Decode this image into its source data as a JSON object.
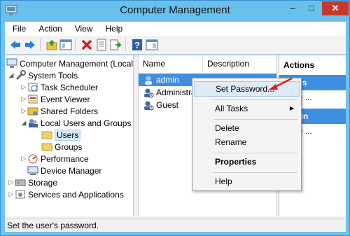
{
  "window": {
    "title": "Computer Management",
    "controls": {
      "minimize": "–",
      "maximize": "□",
      "close": "✕"
    }
  },
  "menubar": {
    "items": [
      "File",
      "Action",
      "View",
      "Help"
    ]
  },
  "toolbar": {
    "icons": [
      "back-icon",
      "forward-icon",
      "up-folder-icon",
      "show-hide-tree-icon",
      "delete-icon",
      "properties-icon",
      "export-icon",
      "help-icon",
      "show-hide-action-pane-icon"
    ]
  },
  "tree": {
    "root": "Computer Management (Local",
    "items": [
      {
        "label": "System Tools",
        "level": 1,
        "expanded": true
      },
      {
        "label": "Task Scheduler",
        "level": 2,
        "expanded": false
      },
      {
        "label": "Event Viewer",
        "level": 2,
        "expanded": false
      },
      {
        "label": "Shared Folders",
        "level": 2,
        "expanded": false
      },
      {
        "label": "Local Users and Groups",
        "level": 2,
        "expanded": true
      },
      {
        "label": "Users",
        "level": 3,
        "selected": true
      },
      {
        "label": "Groups",
        "level": 3
      },
      {
        "label": "Performance",
        "level": 2,
        "expanded": false
      },
      {
        "label": "Device Manager",
        "level": 2
      },
      {
        "label": "Storage",
        "level": 1,
        "expanded": false
      },
      {
        "label": "Services and Applications",
        "level": 1,
        "expanded": false
      }
    ]
  },
  "list": {
    "columns": [
      "Name",
      "Description"
    ],
    "rows": [
      {
        "name": "admin",
        "selected": true
      },
      {
        "name": "Administrat"
      },
      {
        "name": "Guest"
      }
    ]
  },
  "actions": {
    "header": "Actions",
    "section1": "Users",
    "more1": "More ...",
    "section2": "admin",
    "more2": "More ..."
  },
  "context_menu": {
    "items": [
      {
        "label": "Set Password...",
        "highlighted": true
      },
      {
        "label": "All Tasks",
        "submenu": true
      },
      {
        "label": "Delete"
      },
      {
        "label": "Rename"
      },
      {
        "label": "Properties",
        "bold": true
      },
      {
        "label": "Help"
      }
    ]
  },
  "status": {
    "text": "Set the user's password."
  },
  "colors": {
    "title_bar": "#69c0ec",
    "selection": "#3f8fe0",
    "close_button": "#c7382c",
    "annotation_arrow": "#e02020"
  }
}
